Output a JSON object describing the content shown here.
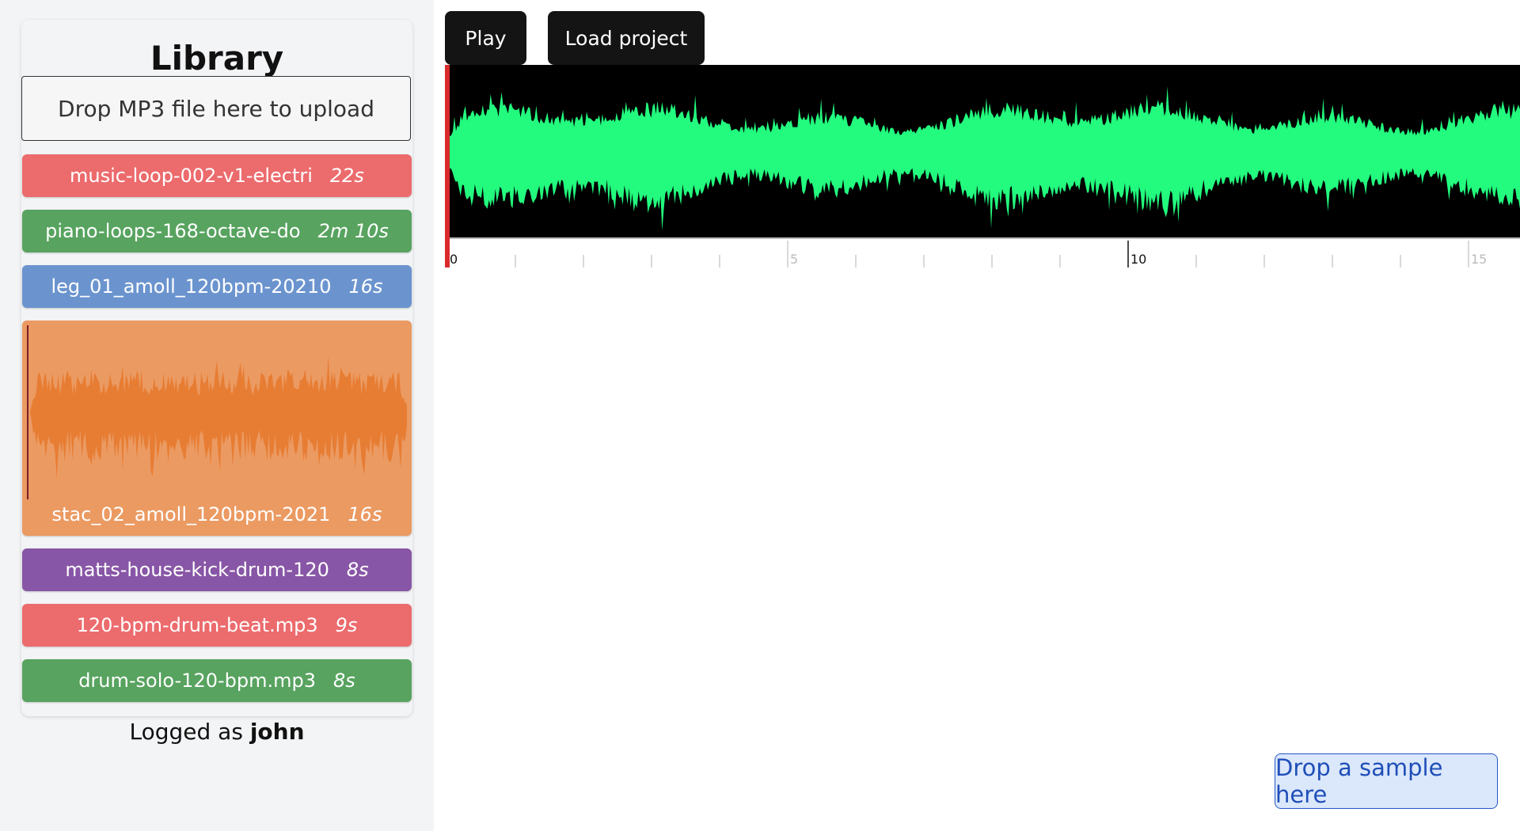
{
  "library": {
    "title": "Library",
    "upload_label": "Drop MP3 file here to upload",
    "samples": [
      {
        "name": "music-loop-002-v1-electri",
        "duration": "22s",
        "color": "#ec6b6d",
        "expanded": false
      },
      {
        "name": "piano-loops-168-octave-do",
        "duration": "2m 10s",
        "color": "#57a35f",
        "expanded": false
      },
      {
        "name": "leg_01_amoll_120bpm-20210",
        "duration": "16s",
        "color": "#6b94cf",
        "expanded": false
      },
      {
        "name": "stac_02_amoll_120bpm-2021",
        "duration": "16s",
        "color": "#eb9a62",
        "wave_color": "#e77d33",
        "expanded": true
      },
      {
        "name": "matts-house-kick-drum-120",
        "duration": "8s",
        "color": "#8856a6",
        "expanded": false
      },
      {
        "name": "120-bpm-drum-beat.mp3",
        "duration": "9s",
        "color": "#ec6b6d",
        "expanded": false
      },
      {
        "name": "drum-solo-120-bpm.mp3",
        "duration": "8s",
        "color": "#57a35f",
        "expanded": false
      }
    ]
  },
  "session": {
    "logged_prefix": "Logged as",
    "username": "john"
  },
  "toolbar": {
    "play_label": "Play",
    "load_label": "Load project"
  },
  "timeline": {
    "waveform_color": "#22fb7e",
    "background_color": "#000000",
    "cursor_color": "#d92b2b",
    "cursor_position_seconds": 0,
    "tick_labels": [
      "0",
      "5",
      "10",
      "15"
    ],
    "visible_seconds": 15.7
  },
  "drop_target": {
    "label": "Drop a sample here"
  }
}
